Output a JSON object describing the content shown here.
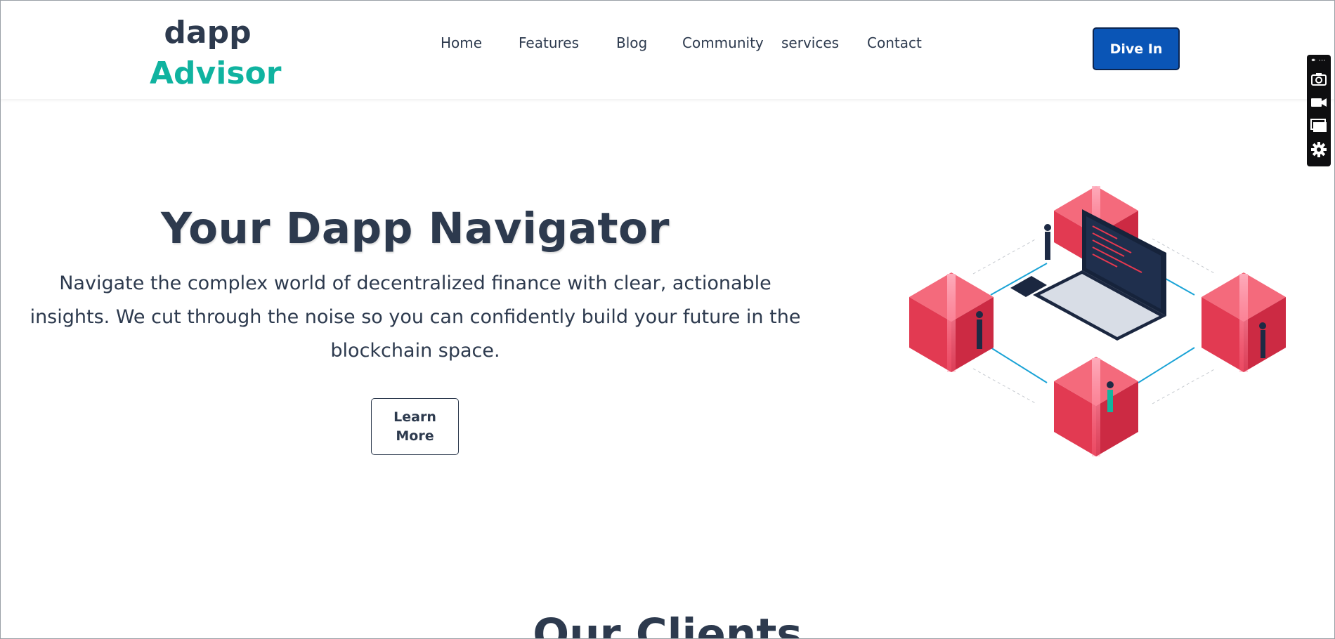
{
  "brand": {
    "line1": "dapp",
    "line2": "Advisor"
  },
  "nav": [
    "Home",
    "Features",
    "Blog",
    "Community",
    "services",
    "Contact"
  ],
  "cta": "Dive In",
  "hero": {
    "title": "Your Dapp Navigator",
    "description": "Navigate the complex world of decentralized finance with clear, actionable insights. We cut through the noise so you can confidently build your future in the blockchain space.",
    "button": "Learn More"
  },
  "section_title": "Our Clients",
  "toolbar": {
    "icons": [
      "link-icon",
      "more-icon",
      "camera-icon",
      "video-icon",
      "window-icon",
      "gear-icon"
    ],
    "more_glyph": "⋯"
  },
  "colors": {
    "accent": "#10b3a0",
    "primary": "#0a55b6",
    "text": "#2d3a4e",
    "cube": "#e8384f"
  }
}
